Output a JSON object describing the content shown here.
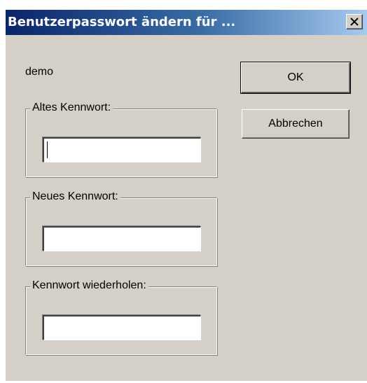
{
  "window": {
    "title": "Benutzerpasswort ändern für ...",
    "close_icon": "close-icon"
  },
  "user": {
    "name": "demo"
  },
  "fields": {
    "old_password": {
      "label": "Altes Kennwort:",
      "value": ""
    },
    "new_password": {
      "label": "Neues Kennwort:",
      "value": ""
    },
    "repeat_password": {
      "label": "Kennwort wiederholen:",
      "value": ""
    }
  },
  "buttons": {
    "ok_label": "OK",
    "cancel_label": "Abbrechen"
  },
  "colors": {
    "dialog_bg": "#d4d0c8",
    "titlebar_start": "#0a246a",
    "titlebar_end": "#a6caf0"
  }
}
